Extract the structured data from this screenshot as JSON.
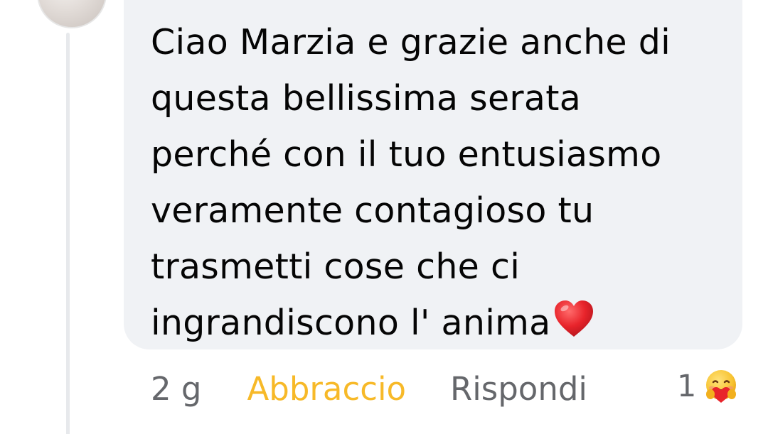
{
  "comment": {
    "lines": [
      "Ciao Marzia e grazie anche di",
      "questa bellissima serata",
      "perché con il tuo entusiasmo",
      "veramente contagioso tu",
      "trasmetti cose che ci",
      "ingrandiscono l' anima"
    ],
    "trailing_emoji": "red-heart-icon"
  },
  "actions": {
    "time": "2 g",
    "reaction_label": "Abbraccio",
    "reply_label": "Rispondi",
    "reaction_count": "1",
    "reaction_icon": "hug-emoji-icon"
  },
  "colors": {
    "bubble": "#f0f2f5",
    "text": "#050505",
    "secondary_text": "#65676b",
    "hug_reaction": "#f7b928",
    "heart": "#e0245e"
  }
}
